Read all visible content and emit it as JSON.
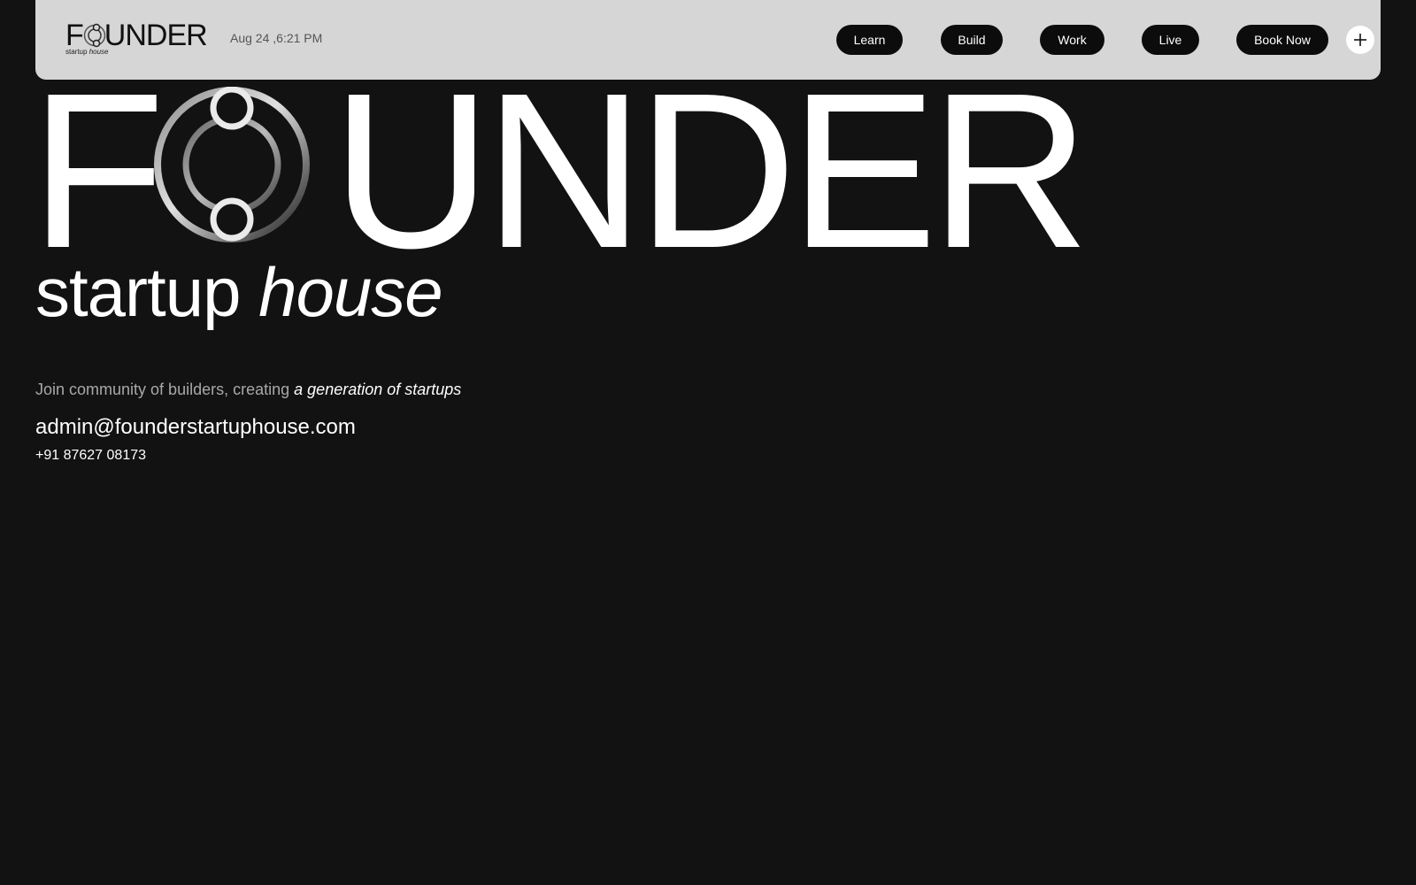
{
  "header": {
    "brand": {
      "word_before": "F",
      "word_after": "UNDER",
      "tagline_plain": "startup",
      "tagline_italic": "house",
      "icon": "founder-o-logo-icon"
    },
    "datetime": "Aug 24 ,6:21 PM",
    "nav": [
      {
        "label": "Learn"
      },
      {
        "label": "Build"
      },
      {
        "label": "Work"
      },
      {
        "label": "Live"
      },
      {
        "label": "Book Now"
      }
    ],
    "menu_icon": "plus-icon"
  },
  "hero": {
    "title_before": "F",
    "title_after": "UNDER",
    "subtitle_plain": "startup",
    "subtitle_italic": "house",
    "tagline_plain": "Join community of builders, creating",
    "tagline_italic": "a generation of startups",
    "email": "admin@founderstartuphouse.com",
    "phone": "+91 87627 08173"
  },
  "colors": {
    "background": "#121212",
    "header_bg": "#d6d6d6",
    "pill_bg": "#0c0c0c",
    "text_primary": "#ffffff",
    "text_muted": "#a8a8a8"
  }
}
